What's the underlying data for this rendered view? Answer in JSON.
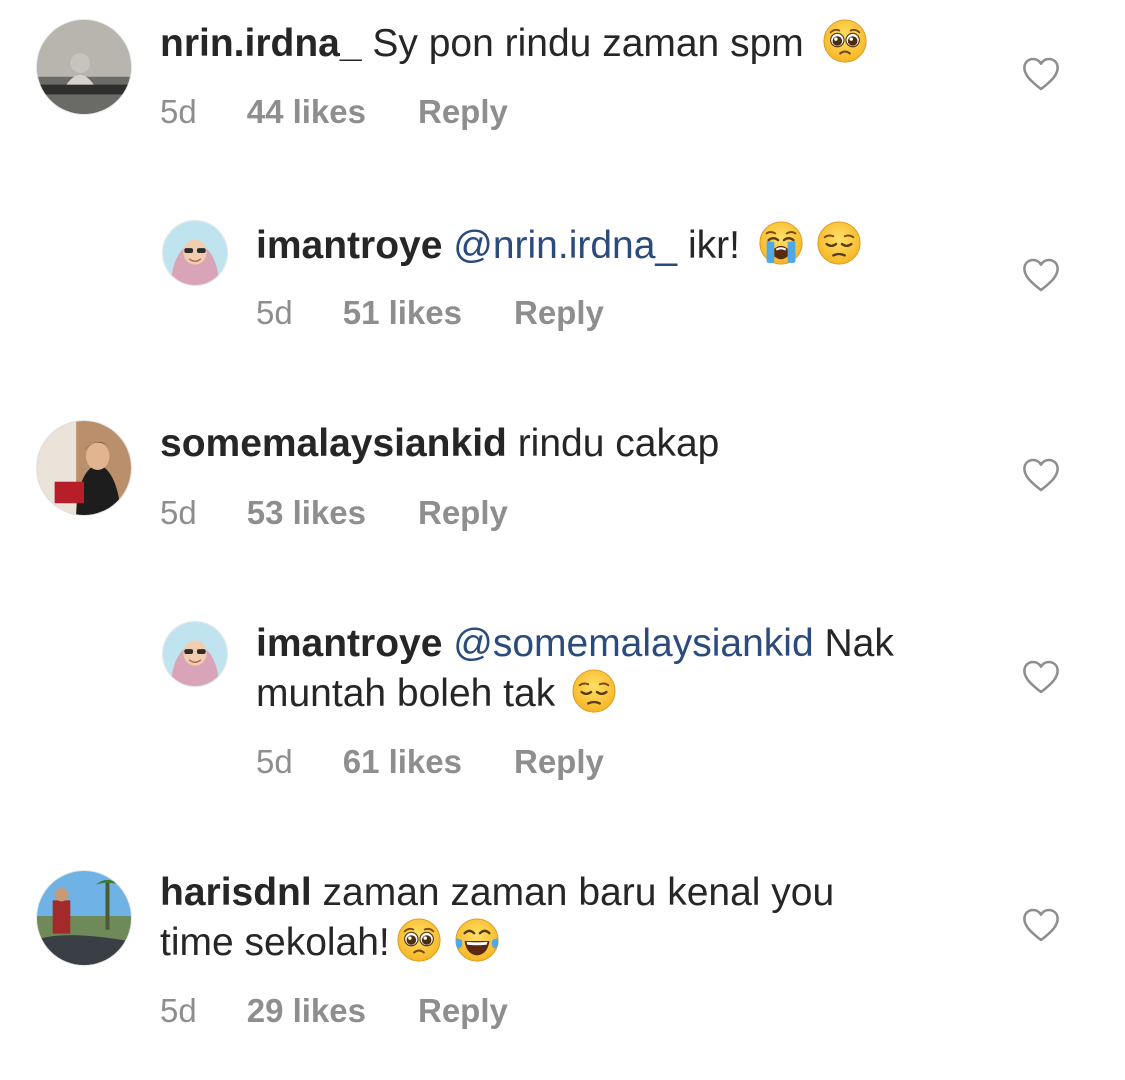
{
  "comments": [
    {
      "username": "nrin.irdna_",
      "mention": "",
      "text": " Sy pon rindu zaman spm",
      "text2": "",
      "time": "5d",
      "likes": "44 likes",
      "reply": "Reply",
      "emojis": [
        "pleading-face-emoji"
      ]
    },
    {
      "username": "imantroye",
      "mention": " @nrin.irdna_",
      "text": " ikr!",
      "text2": "",
      "time": "5d",
      "likes": "51 likes",
      "reply": "Reply",
      "emojis": [
        "loudly-crying-face-emoji",
        "pensive-face-emoji"
      ]
    },
    {
      "username": "somemalaysiankid",
      "mention": "",
      "text": " rindu cakap",
      "text2": "",
      "time": "5d",
      "likes": "53 likes",
      "reply": "Reply",
      "emojis": []
    },
    {
      "username": "imantroye",
      "mention": " @somemalaysiankid",
      "text": " Nak",
      "text2": "muntah boleh tak",
      "time": "5d",
      "likes": "61 likes",
      "reply": "Reply",
      "emojis": [
        "pensive-face-emoji"
      ]
    },
    {
      "username": "harisdnl",
      "mention": "",
      "text": " zaman zaman baru kenal you",
      "text2": "time sekolah!",
      "time": "5d",
      "likes": "29 likes",
      "reply": "Reply",
      "emojis": [
        "pleading-face-emoji",
        "tears-of-joy-emoji"
      ]
    }
  ],
  "colors": {
    "text": "#262626",
    "meta": "#8e8e8e",
    "mention": "#2a4b7c",
    "heart_outline": "#8e8e8e"
  },
  "icons": {
    "like": "heart-outline-icon"
  }
}
